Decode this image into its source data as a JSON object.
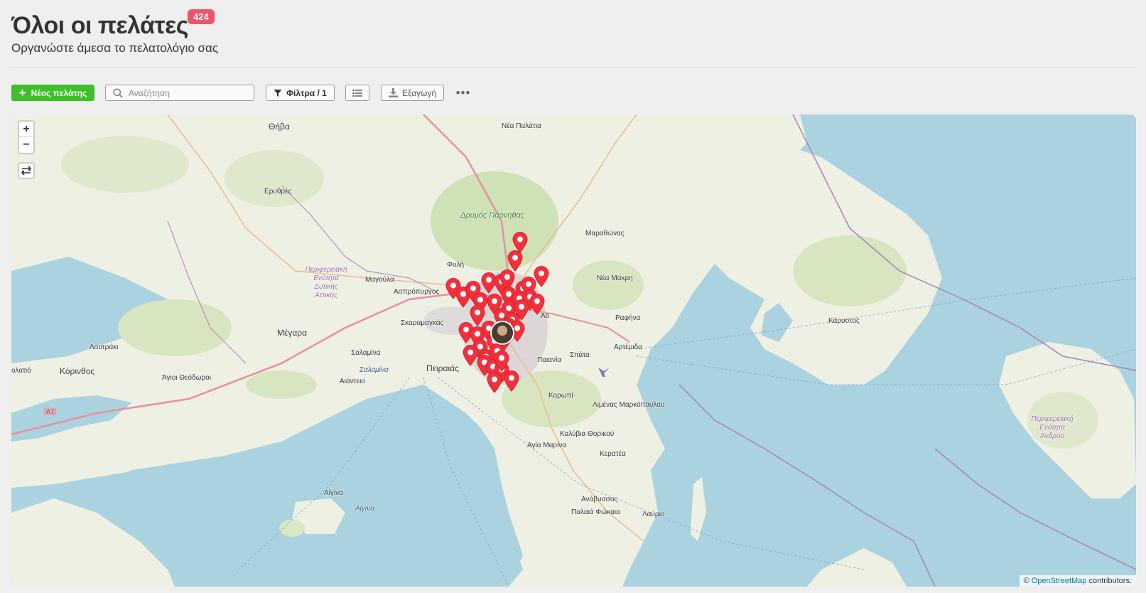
{
  "header": {
    "title": "Όλοι οι πελάτες",
    "count": "424",
    "subtitle": "Οργανώστε άμεσα το πελατολόγιο σας"
  },
  "toolbar": {
    "new_label": "Νέος πελάτης",
    "search_placeholder": "Αναζήτηση",
    "filter_label": "Φίλτρα / 1",
    "export_label": "Εξαγωγή",
    "more_label": "•••"
  },
  "map": {
    "zoom_in": "+",
    "zoom_out": "−",
    "attribution_prefix": "©",
    "attribution_link": "OpenStreetMap",
    "attribution_suffix": "contributors.",
    "places": {
      "thiva": "Θήβα",
      "nea_palatia": "Νέα Παλάτια",
      "erythres": "Ερυθρές",
      "parnitha": "Δρυμός Πάρνηθας",
      "marathonas": "Μαραθώνας",
      "region_west_attica": "Περιφερειακή Ενότητα Δυτικής Αττικής",
      "fyli": "Φυλή",
      "nea_makri": "Νέα Μάκρη",
      "magoula": "Μαγούλα",
      "aspropyrgos": "Ασπρόπυργος",
      "skaramagkas": "Σκαραμαγκάς",
      "a6": "A6",
      "rafina": "Ραφήνα",
      "karystos": "Κάρυστος",
      "megara": "Μέγαρα",
      "loutraki": "Λουτράκι",
      "salamina_town": "Σαλαμίνα",
      "artemida": "Αρτέμιδα",
      "spata": "Σπάτα",
      "paiania": "Παιανία",
      "korinthos": "Κόρινθος",
      "loutraki_west": "ολατιό",
      "salamina_island": "Σαλαμίνα",
      "peiraias": "Πειραιάς",
      "agioi_theodoroi": "Άγιοι Θεόδωροι",
      "aianteio": "Αιάντειο",
      "koropi": "Κορωπί",
      "limenas_markopoulou": "Λιμένας Μαρκόπουλου",
      "a7": "A7",
      "region_andros": "Περιφερειακή Ενότητα Άνδρου",
      "kalyvia": "Καλύβια Θορικού",
      "agia_marina": "Αγία Μαρίνα",
      "keratea": "Κερατέα",
      "aigina_town": "Αίγινα",
      "aigina_island": "Αίγινα",
      "anavyssos": "Ανάβυσσος",
      "palaia_fokaia": "Παλαιά Φώκαια",
      "lavrio": "Λαύριο"
    }
  }
}
